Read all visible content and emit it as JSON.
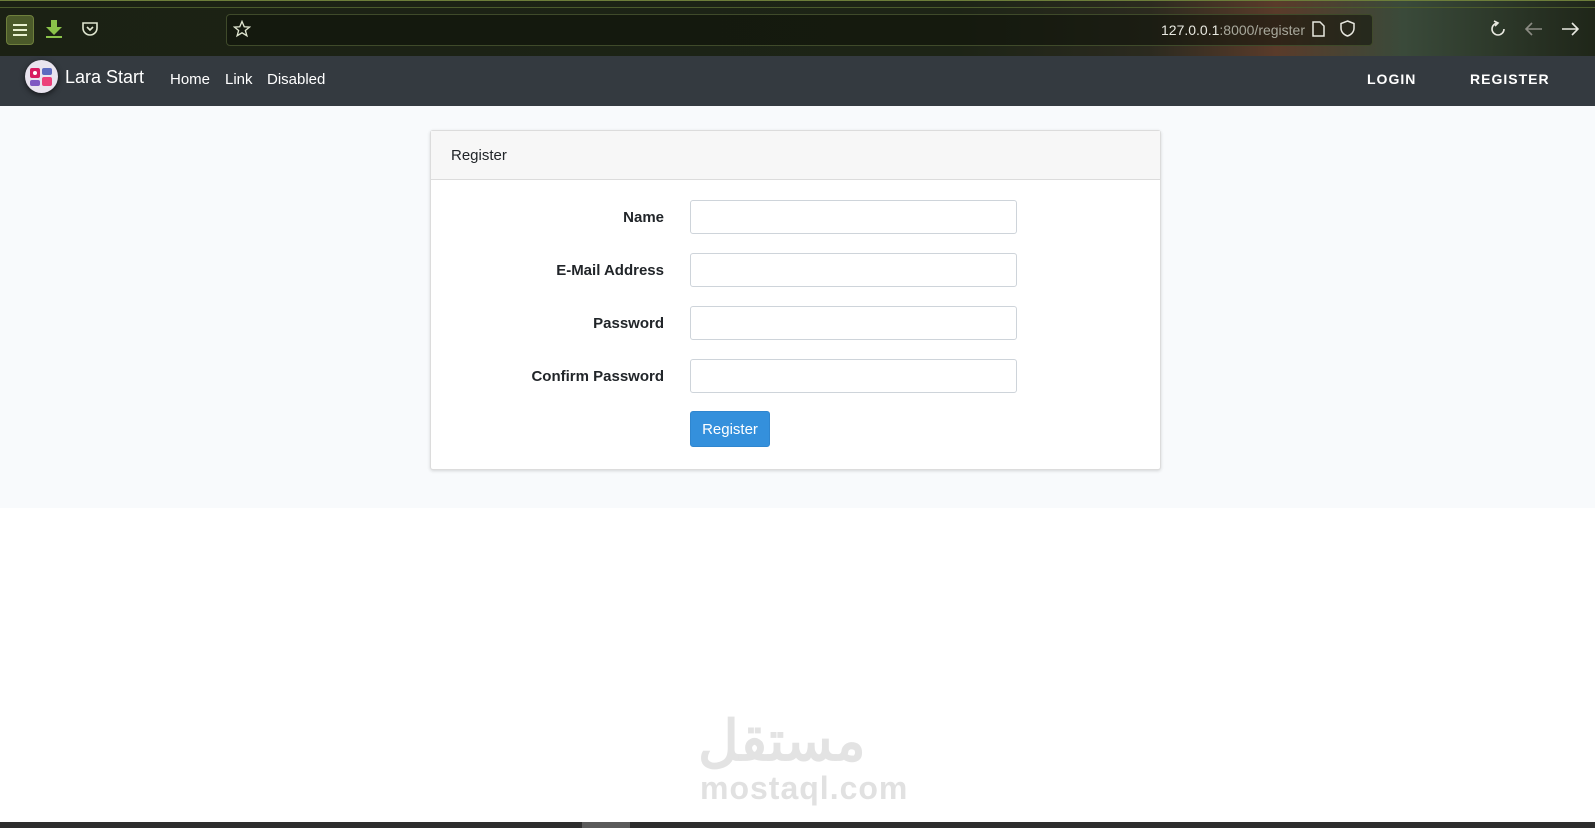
{
  "browser": {
    "url_host": "127.0.0.1",
    "url_rest": ":8000/register",
    "icons": {
      "menu": "hamburger-icon",
      "download": "download-arrow-icon",
      "pocket": "pocket-icon",
      "bookmark": "star-icon",
      "page": "page-icon",
      "shield": "shield-icon",
      "reload": "reload-icon",
      "back": "arrow-left-icon",
      "forward": "arrow-right-icon"
    },
    "accent": "#8bc34a"
  },
  "navbar": {
    "brand": "Lara Start",
    "links": [
      "Home",
      "Link",
      "Disabled"
    ],
    "right": {
      "login": "LOGIN",
      "register": "REGISTER"
    },
    "background": "#343a40"
  },
  "card": {
    "title": "Register",
    "fields": [
      {
        "label": "Name",
        "value": ""
      },
      {
        "label": "E-Mail Address",
        "value": ""
      },
      {
        "label": "Password",
        "value": ""
      },
      {
        "label": "Confirm Password",
        "value": ""
      }
    ],
    "submit_label": "Register",
    "button_color": "#3490dc"
  },
  "watermark": {
    "arabic": "مستقل",
    "latin": "mostaql.com"
  }
}
